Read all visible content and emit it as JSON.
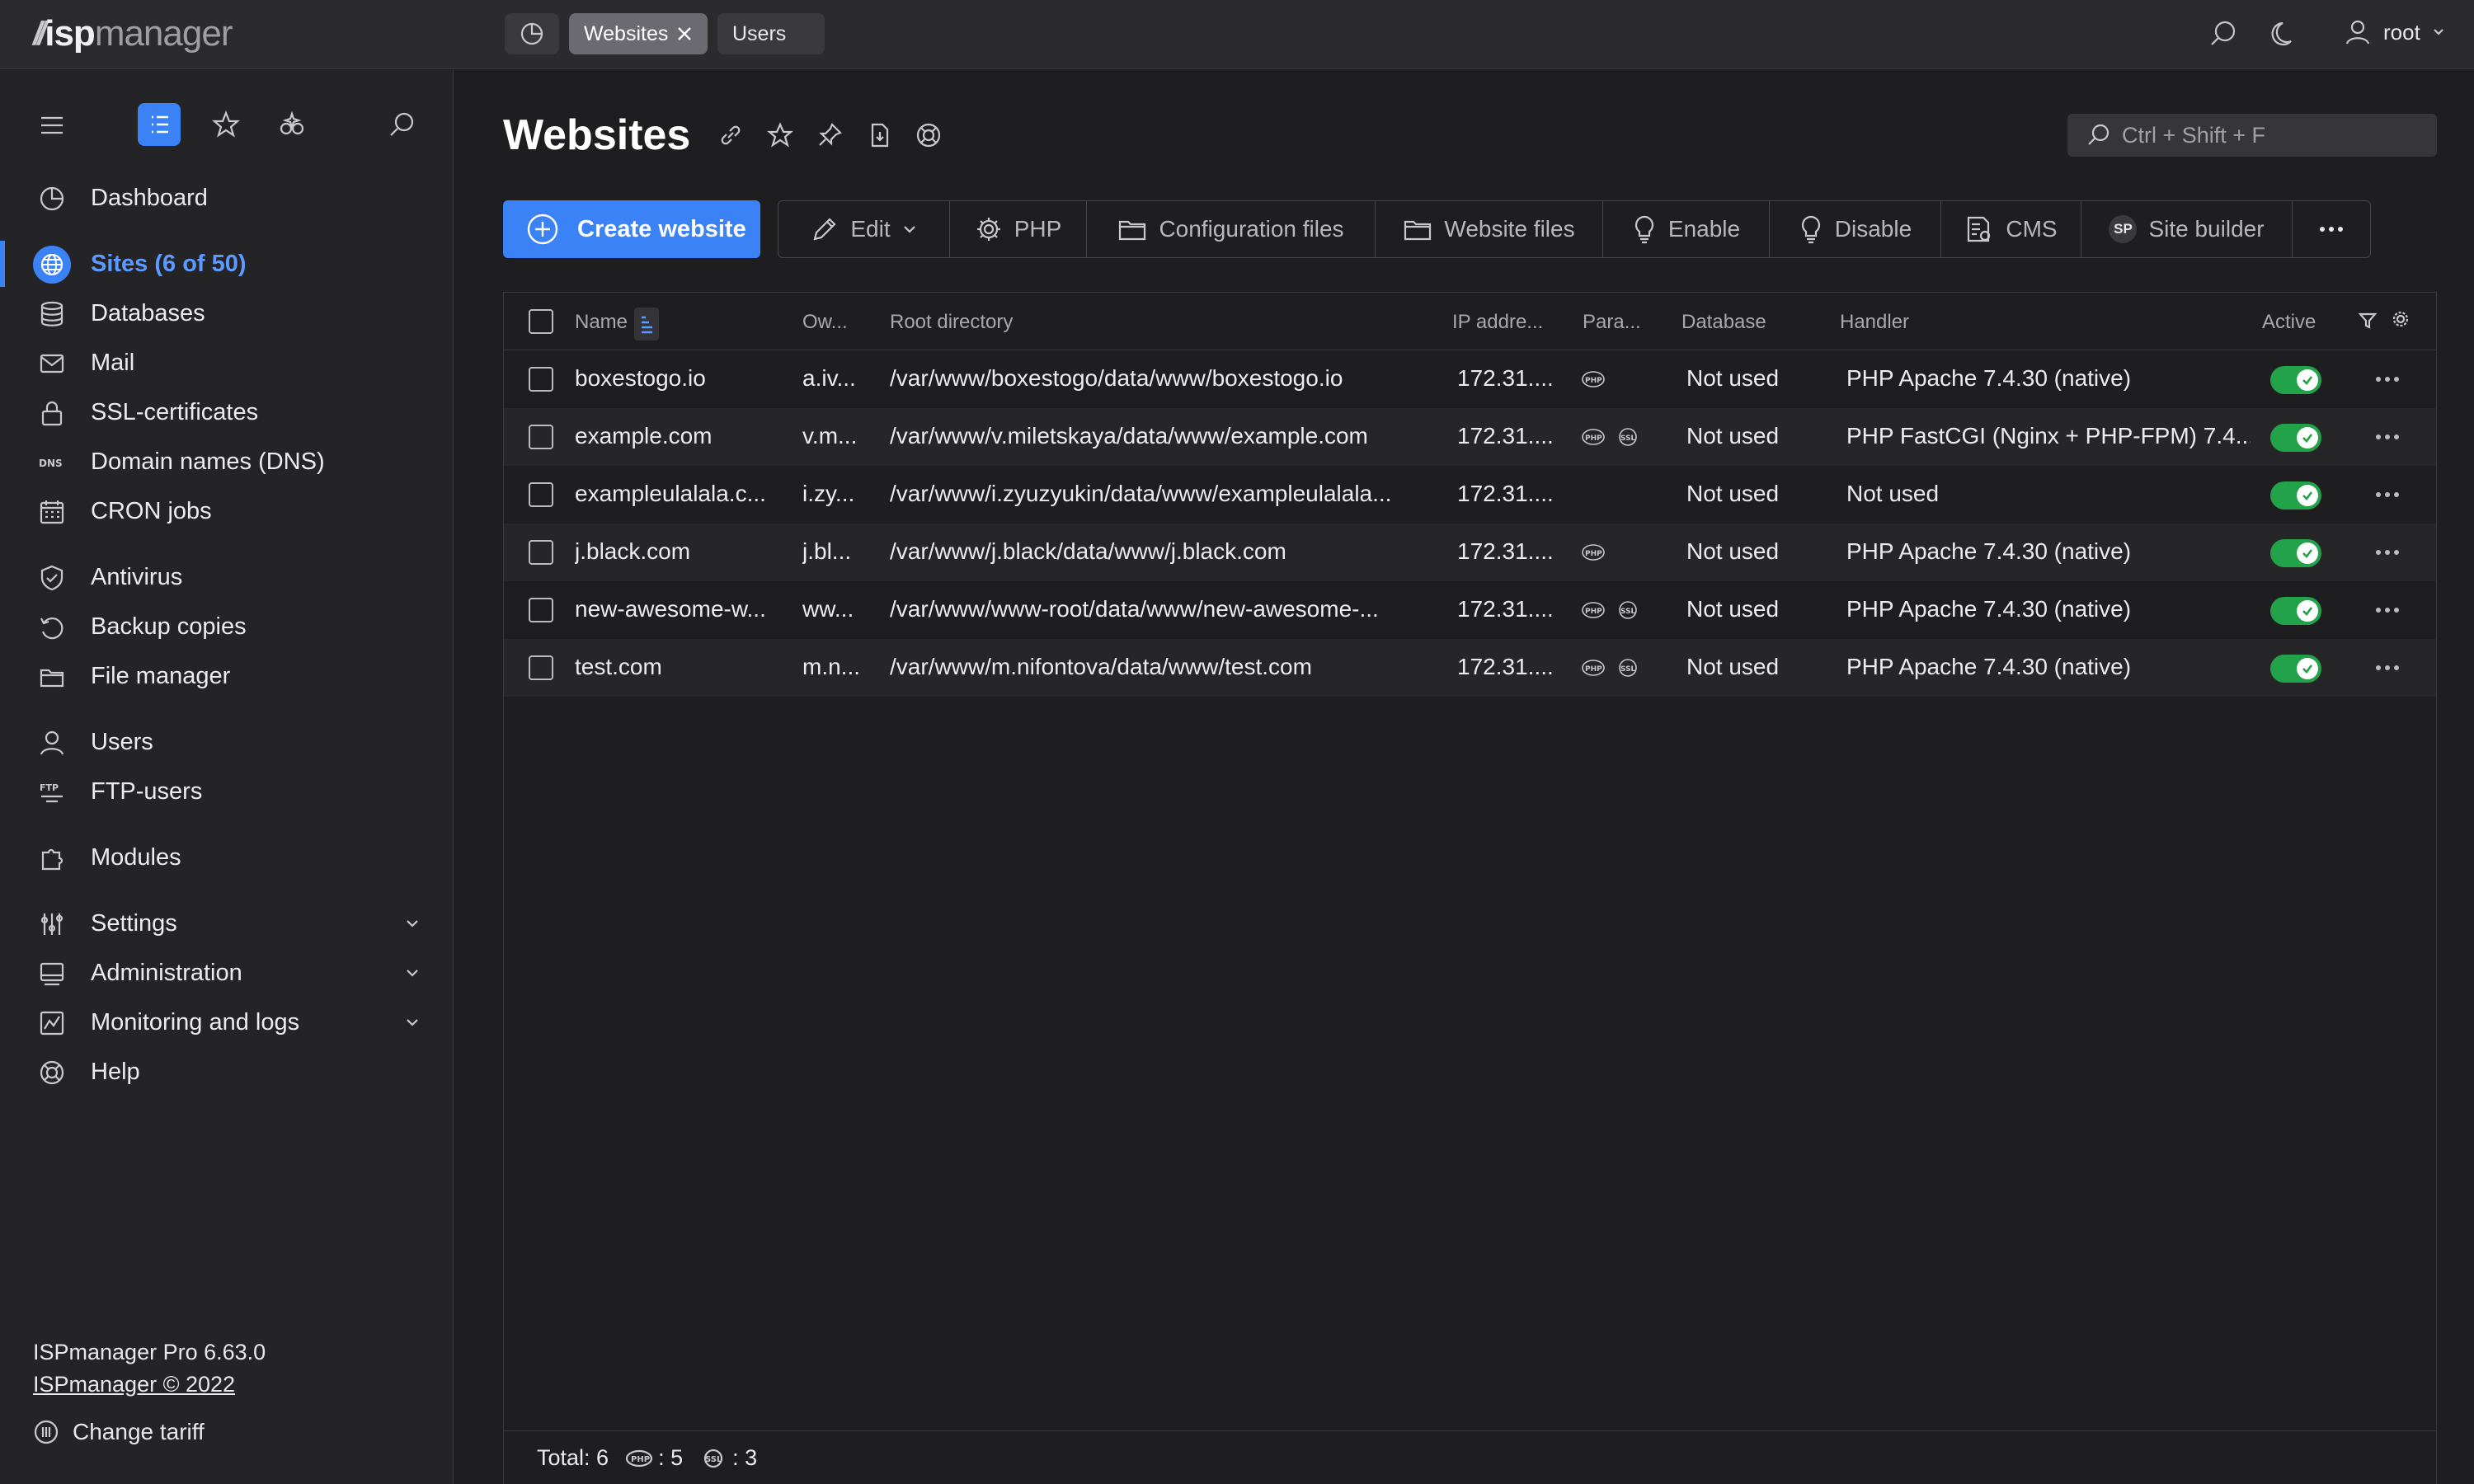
{
  "app": {
    "logo_isp": "isp",
    "logo_manager": "manager"
  },
  "tabs": [
    {
      "label": "Websites",
      "active": true
    },
    {
      "label": "Users",
      "active": false
    }
  ],
  "user": {
    "name": "root"
  },
  "sidebar": {
    "items": [
      {
        "label": "Dashboard",
        "icon": "dashboard-icon"
      },
      {
        "label": "Sites (6 of 50)",
        "icon": "globe-icon",
        "active": true
      },
      {
        "label": "Databases",
        "icon": "database-icon"
      },
      {
        "label": "Mail",
        "icon": "mail-icon"
      },
      {
        "label": "SSL-certificates",
        "icon": "lock-icon"
      },
      {
        "label": "Domain names (DNS)",
        "icon": "dns-icon",
        "icon_text": "DNS"
      },
      {
        "label": "CRON jobs",
        "icon": "calendar-icon"
      },
      {
        "label": "Antivirus",
        "icon": "shield-icon"
      },
      {
        "label": "Backup copies",
        "icon": "backup-icon"
      },
      {
        "label": "File manager",
        "icon": "folder-icon"
      },
      {
        "label": "Users",
        "icon": "user-icon"
      },
      {
        "label": "FTP-users",
        "icon": "ftp-icon",
        "icon_text": "FTP"
      },
      {
        "label": "Modules",
        "icon": "puzzle-icon"
      },
      {
        "label": "Settings",
        "icon": "sliders-icon"
      },
      {
        "label": "Administration",
        "icon": "server-icon"
      },
      {
        "label": "Monitoring and logs",
        "icon": "chart-icon"
      },
      {
        "label": "Help",
        "icon": "help-icon"
      }
    ],
    "footer": {
      "version": "ISPmanager Pro 6.63.0",
      "copyright": "ISPmanager © 2022",
      "change_tariff": "Change tariff"
    }
  },
  "page": {
    "title": "Websites",
    "search_placeholder": "Ctrl + Shift + F"
  },
  "toolbar": {
    "create": "Create website",
    "buttons": [
      "Edit",
      "PHP",
      "Configuration files",
      "Website files",
      "Enable",
      "Disable",
      "CMS",
      "Site builder"
    ],
    "sp_badge": "SP"
  },
  "table": {
    "columns": [
      "Name",
      "Ow...",
      "Root directory",
      "IP addre...",
      "Para...",
      "Database",
      "Handler",
      "Active"
    ],
    "rows": [
      {
        "name": "boxestogo.io",
        "owner": "a.iv...",
        "root": "/var/www/boxestogo/data/www/boxestogo.io",
        "ip": "172.31....",
        "php": true,
        "ssl": false,
        "database": "Not used",
        "handler": "PHP Apache 7.4.30 (native)",
        "active": true
      },
      {
        "name": "example.com",
        "owner": "v.m...",
        "root": "/var/www/v.miletskaya/data/www/example.com",
        "ip": "172.31....",
        "php": true,
        "ssl": true,
        "database": "Not used",
        "handler": "PHP FastCGI (Nginx + PHP-FPM) 7.4....",
        "active": true
      },
      {
        "name": "exampleulalala.c...",
        "owner": "i.zy...",
        "root": "/var/www/i.zyuzyukin/data/www/exampleulalala...",
        "ip": "172.31....",
        "php": false,
        "ssl": false,
        "database": "Not used",
        "handler": "Not used",
        "active": true
      },
      {
        "name": "j.black.com",
        "owner": "j.bl...",
        "root": "/var/www/j.black/data/www/j.black.com",
        "ip": "172.31....",
        "php": true,
        "ssl": false,
        "database": "Not used",
        "handler": "PHP Apache 7.4.30 (native)",
        "active": true
      },
      {
        "name": "new-awesome-w...",
        "owner": "ww...",
        "root": "/var/www/www-root/data/www/new-awesome-...",
        "ip": "172.31....",
        "php": true,
        "ssl": true,
        "database": "Not used",
        "handler": "PHP Apache 7.4.30 (native)",
        "active": true
      },
      {
        "name": "test.com",
        "owner": "m.n...",
        "root": "/var/www/m.nifontova/data/www/test.com",
        "ip": "172.31....",
        "php": true,
        "ssl": true,
        "database": "Not used",
        "handler": "PHP Apache 7.4.30 (native)",
        "active": true
      }
    ],
    "footer": {
      "total": "Total: 6",
      "php_count": ": 5",
      "ssl_count": ": 3"
    }
  },
  "colors": {
    "accent": "#3b82f6",
    "active_toggle": "#22a34a",
    "bg": "#1e1e20",
    "sidebar": "#242427",
    "topbar": "#2b2b2e"
  }
}
